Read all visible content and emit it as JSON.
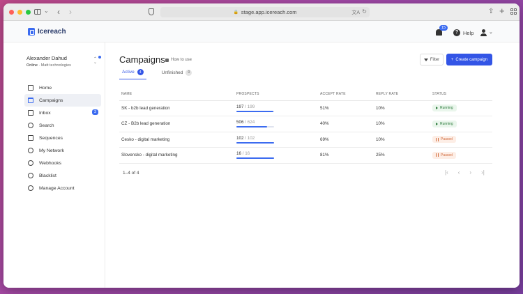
{
  "browser": {
    "url": "stage.app.icereach.com"
  },
  "app": {
    "logo_text": "Icereach",
    "notifications_count": "15",
    "help_label": "Help"
  },
  "profile": {
    "name": "Alexander Dahud",
    "status": "Online",
    "company": "Matt technologies"
  },
  "nav": {
    "items": [
      {
        "label": "Home",
        "icon": "home-icon"
      },
      {
        "label": "Campaigns",
        "icon": "calendar-icon",
        "active": true
      },
      {
        "label": "Inbox",
        "icon": "inbox-icon",
        "badge": "3"
      },
      {
        "label": "Search",
        "icon": "search-icon"
      },
      {
        "label": "Sequences",
        "icon": "list-icon"
      },
      {
        "label": "My Network",
        "icon": "network-icon"
      },
      {
        "label": "Webhooks",
        "icon": "webhook-icon"
      },
      {
        "label": "Blacklist",
        "icon": "blacklist-icon"
      },
      {
        "label": "Manage Account",
        "icon": "account-icon"
      }
    ]
  },
  "main": {
    "title": "Campaigns",
    "how_to": "How to use",
    "filter_label": "Filter",
    "create_label": "Create campaign",
    "tabs": [
      {
        "label": "Active",
        "count": "4"
      },
      {
        "label": "Unfinished",
        "count": "0"
      }
    ],
    "columns": [
      "NAME",
      "PROSPECTS",
      "ACCEPT RATE",
      "REPLY RATE",
      "STATUS"
    ],
    "rows": [
      {
        "name": "SK - b2b lead generation",
        "prospects_done": "197",
        "prospects_total": "/ 199",
        "progress": 0.99,
        "accept": "51%",
        "reply": "10%",
        "status": "Running",
        "state": "running"
      },
      {
        "name": "CZ - B2b lead generation",
        "prospects_done": "506",
        "prospects_total": "/ 624",
        "progress": 0.81,
        "accept": "40%",
        "reply": "10%",
        "status": "Running",
        "state": "running"
      },
      {
        "name": "Cesko - digital marketing",
        "prospects_done": "102",
        "prospects_total": "/ 102",
        "progress": 1.0,
        "accept": "69%",
        "reply": "10%",
        "status": "Paused",
        "state": "paused"
      },
      {
        "name": "Slovensko - digital marketing",
        "prospects_done": "16",
        "prospects_total": "/ 16",
        "progress": 1.0,
        "accept": "81%",
        "reply": "25%",
        "status": "Paused",
        "state": "paused"
      }
    ],
    "pagination": "1–4 of 4"
  },
  "colors": {
    "accent": "#3355e6",
    "running": "#2a7a3a",
    "paused": "#d0693a"
  }
}
